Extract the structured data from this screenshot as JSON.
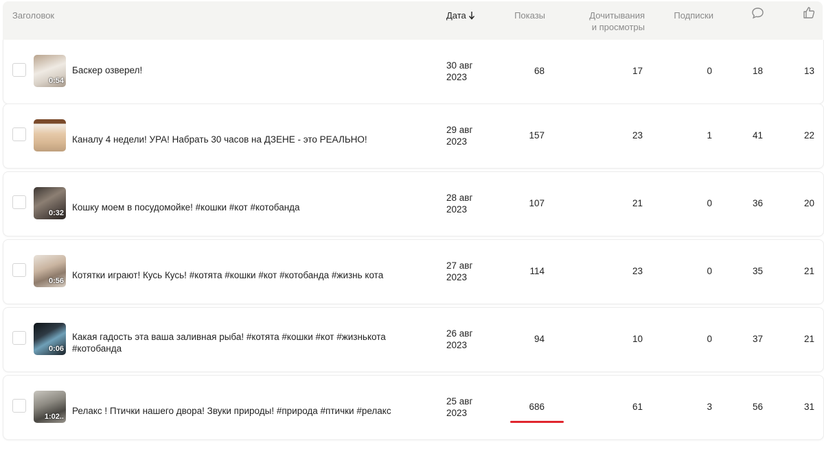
{
  "header": {
    "title": "Заголовок",
    "date": "Дата",
    "views": "Показы",
    "reads_line1": "Дочитывания",
    "reads_line2": "и просмотры",
    "subscriptions": "Подписки"
  },
  "rows": [
    {
      "title_line1": "Баскер озверел!",
      "title_line2": "",
      "duration": "0:54",
      "date_day": "30 авг",
      "date_year": "2023",
      "views": "68",
      "reads": "17",
      "subs": "0",
      "comments": "18",
      "likes": "13",
      "thumb_color": "#d8d0c6"
    },
    {
      "title_line1": "Каналу 4 недели! УРА! Набрать 30 часов на ДЗЕНЕ - это РЕАЛЬНО!",
      "title_line2": "",
      "duration": "",
      "date_day": "29 авг",
      "date_year": "2023",
      "views": "157",
      "reads": "23",
      "subs": "1",
      "comments": "41",
      "likes": "22",
      "thumb_color": "#d7b692"
    },
    {
      "title_line1": "Кошку моем в посудомойке! #кошки #кот #котобанда",
      "title_line2": "",
      "duration": "0:32",
      "date_day": "28 авг",
      "date_year": "2023",
      "views": "107",
      "reads": "21",
      "subs": "0",
      "comments": "36",
      "likes": "20",
      "thumb_color": "#6a5e55"
    },
    {
      "title_line1": "Котятки играют! Кусь Кусь! #котята #кошки #кот #котобанда #жизнь кота",
      "title_line2": "",
      "duration": "0:56",
      "date_day": "27 авг",
      "date_year": "2023",
      "views": "114",
      "reads": "23",
      "subs": "0",
      "comments": "35",
      "likes": "21",
      "thumb_color": "#c9b4a0"
    },
    {
      "title_line1": "Какая гадость эта ваша заливная рыба! #котята #кошки #кот #жизнькота",
      "title_line2": "#котобанда",
      "duration": "0:06",
      "date_day": "26 авг",
      "date_year": "2023",
      "views": "94",
      "reads": "10",
      "subs": "0",
      "comments": "37",
      "likes": "21",
      "thumb_color": "#2e3a44"
    },
    {
      "title_line1": "Релакс ! Птички нашего двора! Звуки природы! #природа #птички #релакс",
      "title_line2": "",
      "duration": "1:02..",
      "date_day": "25 авг",
      "date_year": "2023",
      "views": "686",
      "reads": "61",
      "subs": "3",
      "comments": "56",
      "likes": "31",
      "thumb_color": "#8d8a82"
    }
  ],
  "colors": {
    "accent_underline": "#e0262e",
    "header_bg": "#f4f4f2",
    "muted_text": "#8a8a8a"
  },
  "icons": {
    "sort": "arrow-down-icon",
    "comments": "comment-bubble-icon",
    "likes": "thumbs-up-icon"
  }
}
